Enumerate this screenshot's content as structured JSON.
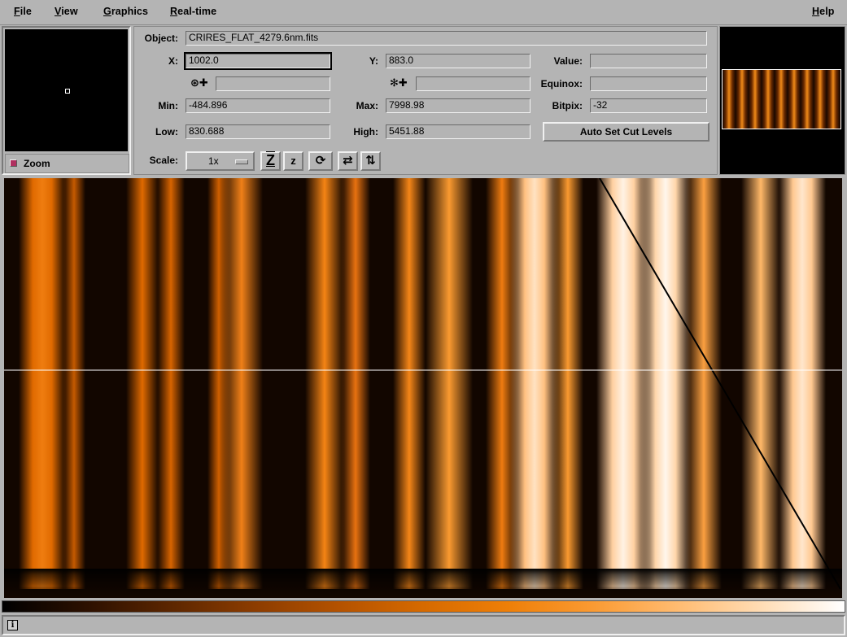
{
  "menubar": {
    "file": {
      "mnemonic": "F",
      "rest": "ile"
    },
    "view": {
      "mnemonic": "V",
      "rest": "iew"
    },
    "graphics": {
      "mnemonic": "G",
      "rest": "raphics"
    },
    "realtime": {
      "mnemonic": "R",
      "rest": "eal-time"
    },
    "help": {
      "mnemonic": "H",
      "rest": "elp"
    }
  },
  "zoom": {
    "label": "Zoom"
  },
  "info": {
    "object_label": "Object:",
    "object_value": "CRIRES_FLAT_4279.6nm.fits",
    "x_label": "X:",
    "x_value": "1002.0",
    "y_label": "Y:",
    "y_value": "883.0",
    "value_label": "Value:",
    "value_value": "",
    "ra_value": "",
    "dec_value": "",
    "equinox_label": "Equinox:",
    "equinox_value": "",
    "min_label": "Min:",
    "min_value": "-484.896",
    "max_label": "Max:",
    "max_value": "7998.98",
    "bitpix_label": "Bitpix:",
    "bitpix_value": "-32",
    "low_label": "Low:",
    "low_value": "830.688",
    "high_label": "High:",
    "high_value": "5451.88",
    "autocut_label": "Auto Set Cut Levels",
    "scale_label": "Scale:",
    "scale_value": "1x"
  },
  "toolbar_icons": [
    "zoom-in-icon",
    "zoom-out-icon",
    "rotate-icon",
    "flip-x-icon",
    "flip-y-icon"
  ],
  "colormap": {
    "start": "#000000",
    "mid": "#ee7f08",
    "end": "#ffffff"
  },
  "status": {
    "icon": "i"
  }
}
